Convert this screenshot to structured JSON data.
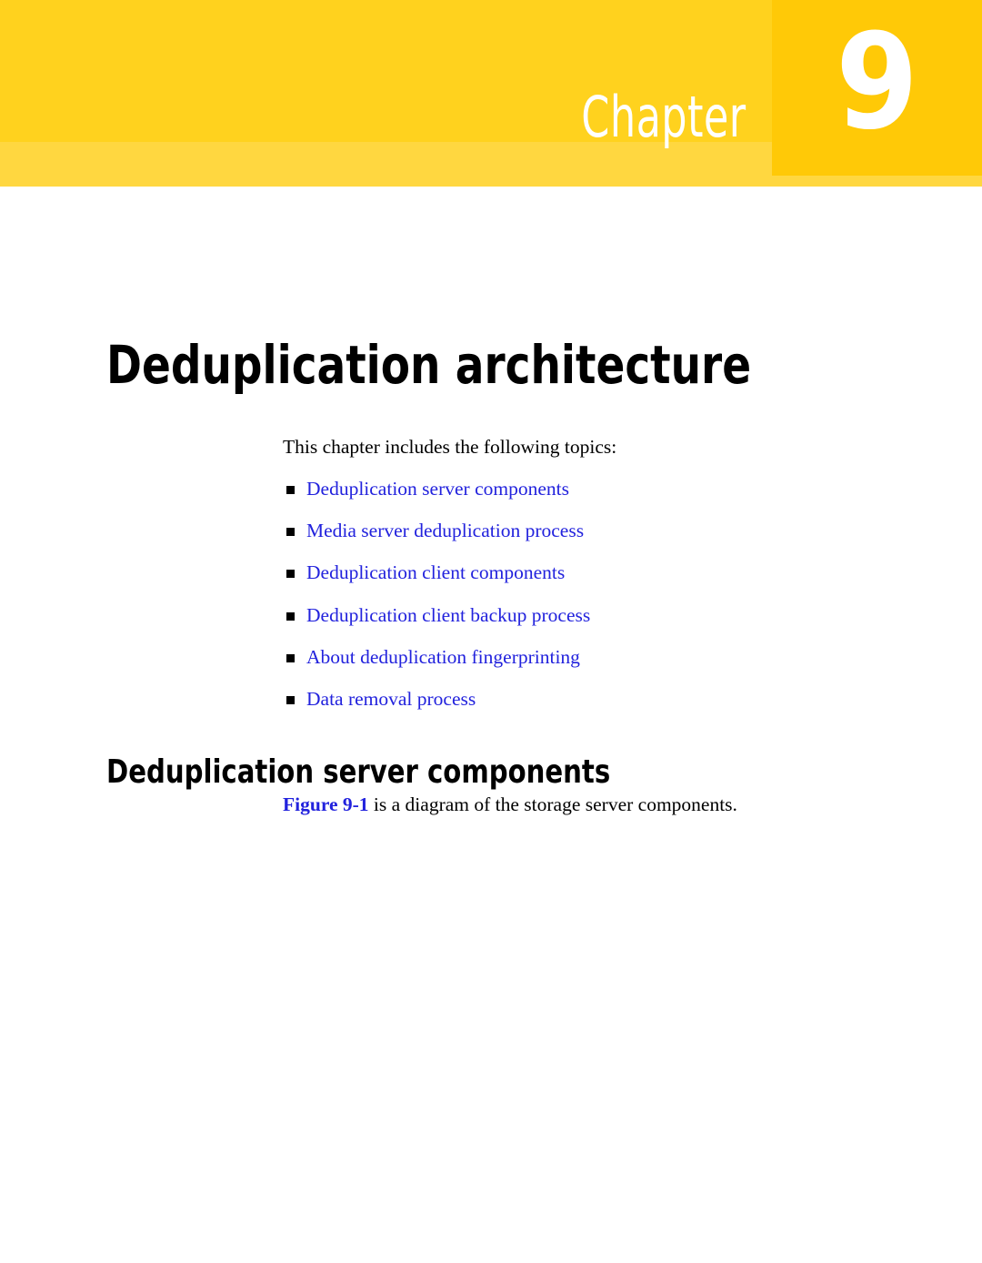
{
  "banner": {
    "chapter_word": "Chapter",
    "chapter_number": "9",
    "main_color": "#ffd21e",
    "number_col_color": "#ffc907",
    "underband_color": "#ffd740",
    "text_color": "#ffffff"
  },
  "page": {
    "title": "Deduplication architecture",
    "intro": "This chapter includes the following topics:",
    "link_color": "#2222dd",
    "text_color": "#000000"
  },
  "topics": [
    {
      "label": "Deduplication server components"
    },
    {
      "label": "Media server deduplication process"
    },
    {
      "label": "Deduplication client components"
    },
    {
      "label": "Deduplication client backup process"
    },
    {
      "label": "About deduplication fingerprinting"
    },
    {
      "label": "Data removal process"
    }
  ],
  "section": {
    "heading": "Deduplication server components",
    "figure_ref_link": "Figure 9-1",
    "figure_ref_text": " is a diagram of the storage server components."
  }
}
